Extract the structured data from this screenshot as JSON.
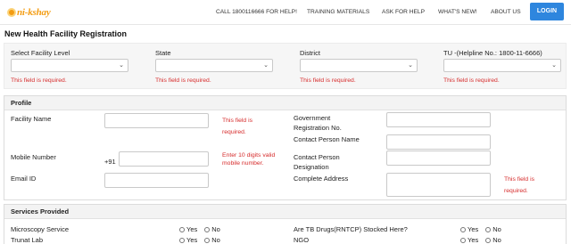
{
  "header": {
    "logo_text": "ni-kshay",
    "nav": [
      {
        "label": "CALL 1800116666 FOR HELP!"
      },
      {
        "label": "TRAINING MATERIALS"
      },
      {
        "label": "ASK FOR HELP"
      },
      {
        "label": "WHAT'S NEW!"
      },
      {
        "label": "ABOUT US"
      }
    ],
    "login_label": "LOGIN"
  },
  "page": {
    "title": "New Health Facility Registration"
  },
  "location": {
    "fields": [
      {
        "label": "Select Facility Level",
        "value": "",
        "error": "This field is required."
      },
      {
        "label": "State",
        "value": "",
        "error": "This field is required."
      },
      {
        "label": "District",
        "value": "",
        "error": "This field is required."
      },
      {
        "label": "TU -(Helpline No.: 1800-11-6666)",
        "value": "",
        "error": "This field is required."
      }
    ]
  },
  "profile": {
    "title": "Profile",
    "facility_name": {
      "label": "Facility Name",
      "value": "",
      "error": "This field is required."
    },
    "mobile": {
      "label": "Mobile Number",
      "prefix": "+91",
      "value": "",
      "error": "Enter 10 digits valid mobile number."
    },
    "email": {
      "label": "Email ID",
      "value": ""
    },
    "gov_reg": {
      "label": "Government Registration No.",
      "value": ""
    },
    "contact_name": {
      "label": "Contact Person Name",
      "value": ""
    },
    "contact_designation": {
      "label": "Contact Person Designation",
      "value": ""
    },
    "address": {
      "label": "Complete Address",
      "value": "",
      "error": "This field is required."
    }
  },
  "services": {
    "title": "Services Provided",
    "yes_label": "Yes",
    "no_label": "No",
    "rows": [
      {
        "left": "Microscopy Service",
        "right": "Are TB Drugs(RNTCP) Stocked Here?"
      },
      {
        "left": "Trunat Lab",
        "right": "NGO"
      }
    ]
  }
}
